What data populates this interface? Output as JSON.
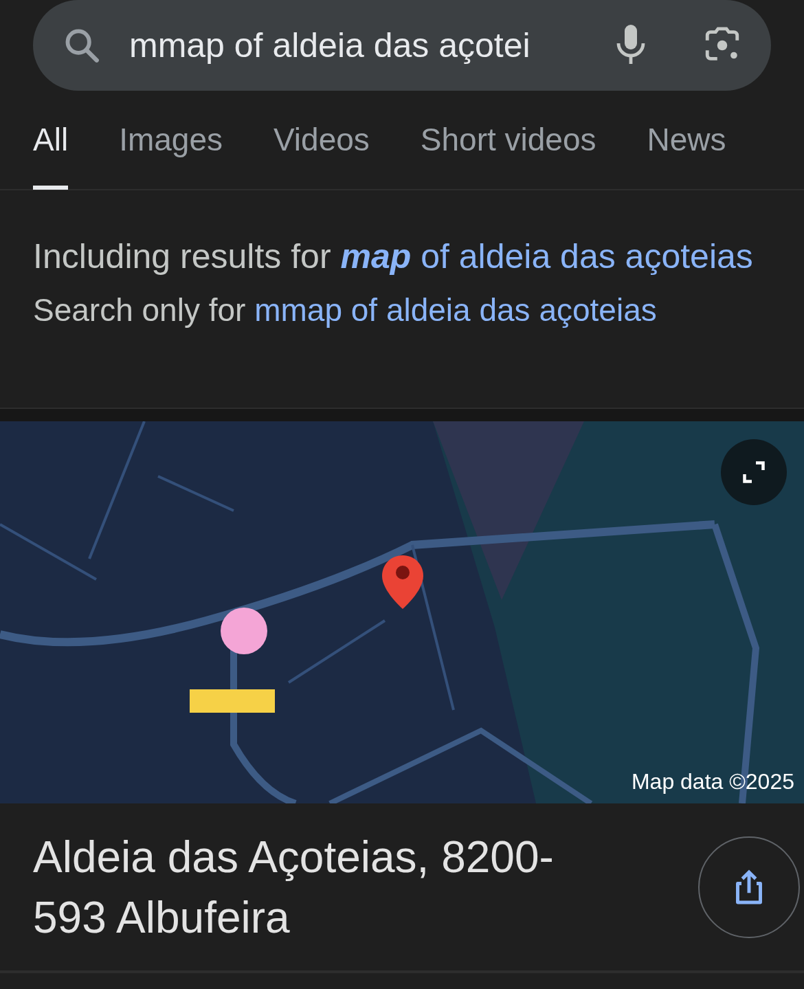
{
  "search": {
    "value": "mmap of aldeia das açotei"
  },
  "tabs": [
    {
      "label": "All",
      "selected": true
    },
    {
      "label": "Images",
      "selected": false
    },
    {
      "label": "Videos",
      "selected": false
    },
    {
      "label": "Short videos",
      "selected": false
    },
    {
      "label": "News",
      "selected": false
    }
  ],
  "spelling": {
    "including_label": "Including results for",
    "corrected_query": "**map** of aldeia das açoteias",
    "search_only_label": "Search only for",
    "original_query": "mmap of aldeia das açoteias"
  },
  "map": {
    "kind": "picture",
    "attribution": "Map data ©2025"
  },
  "place": {
    "address": "Aldeia das Açoteias, 8200-593 Albufeira"
  }
}
